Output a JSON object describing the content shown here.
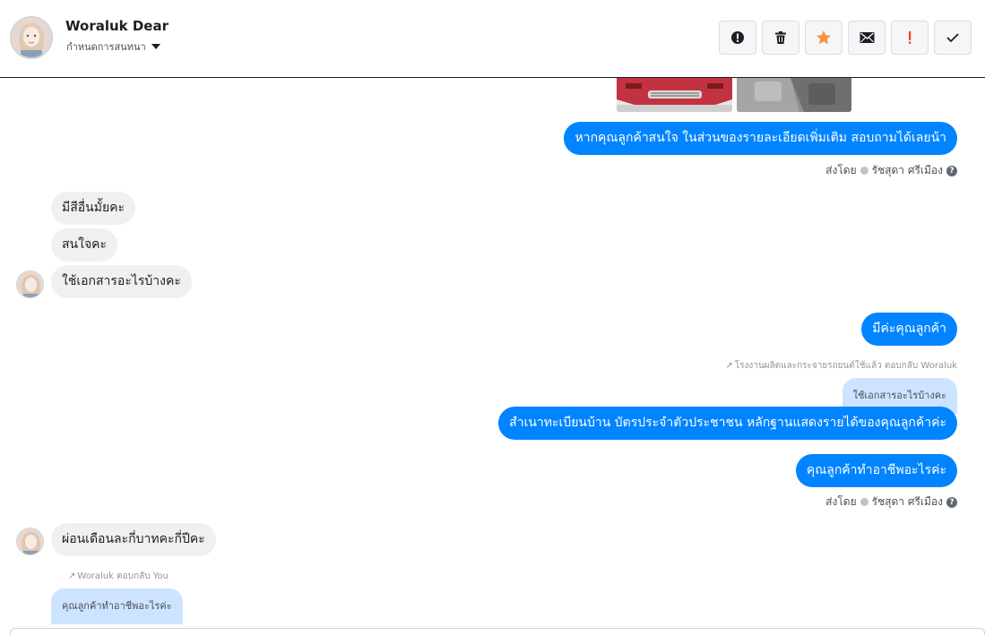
{
  "header": {
    "contact_name": "Woraluk Dear",
    "assign_label": "กำหนดการสนทนา"
  },
  "actions": [
    {
      "name": "report-spam-button",
      "icon": "alert-circle-icon"
    },
    {
      "name": "delete-button",
      "icon": "trash-icon"
    },
    {
      "name": "star-button",
      "icon": "star-icon"
    },
    {
      "name": "mark-unread-button",
      "icon": "envelope-icon"
    },
    {
      "name": "important-button",
      "icon": "exclamation-icon"
    },
    {
      "name": "mark-done-button",
      "icon": "check-icon"
    }
  ],
  "messages": {
    "out1": "หากคุณลูกค้าสนใจ ในส่วนของรายละเอียดเพิ่มเติม สอบถามได้เลยน้า",
    "sent_by_1": {
      "prefix": "ส่งโดย",
      "name": "รัชสุดา ศรีเมือง"
    },
    "in1": "มีสีอื่นมั้ยคะ",
    "in2": "สนใจคะ",
    "in3": "ใช้เอกสารอะไรบ้างคะ",
    "out2": "มีค่ะคุณลูกค้า",
    "reply_meta_1": "โรงงานผลิตและกระจายรถยนต์ใช้แล้ว ตอบกลับ Woraluk",
    "quote_1": "ใช้เอกสารอะไรบ้างคะ",
    "out3": "สำเนาทะเบียนบ้าน บัตรประจำตัวประชาชน หลักฐานแสดงรายได้ของคุณลูกค้าค่ะ",
    "out4": "คุณลูกค้าทำอาชีพอะไรค่ะ",
    "sent_by_2": {
      "prefix": "ส่งโดย",
      "name": "รัชสุดา ศรีเมือง"
    },
    "in4": "ผ่อนเดือนละกี่บาทคะกี่ปีคะ",
    "reply_meta_2": "Woraluk ตอบกลับ You",
    "quote_2": "คุณลูกค้าทำอาชีพอะไรค่ะ"
  },
  "colors": {
    "brand_blue": "#0084ff",
    "incoming_gray": "#f1f0f0",
    "quote_blue": "#cce4ff",
    "star_orange": "#f7923b",
    "important_red": "#e9471e"
  }
}
